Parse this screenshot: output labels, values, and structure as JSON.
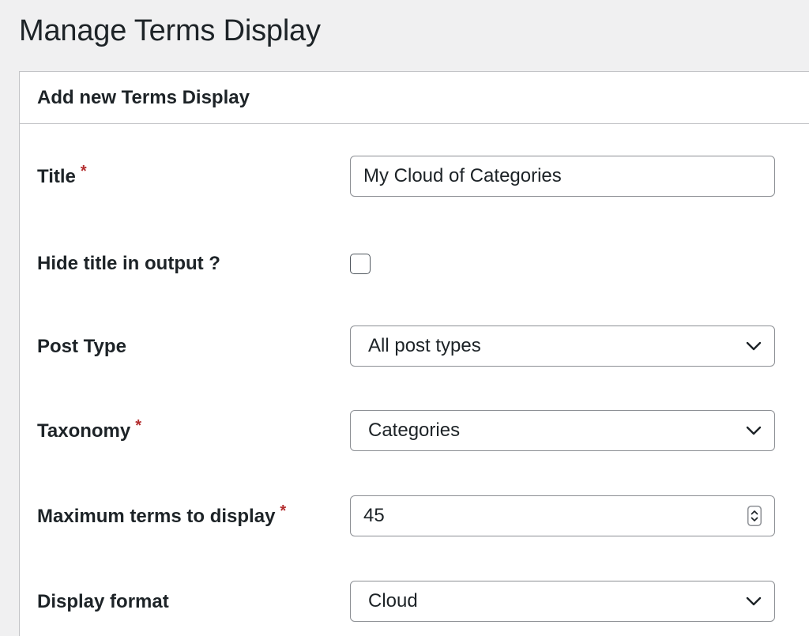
{
  "page": {
    "title": "Manage Terms Display"
  },
  "panel": {
    "heading": "Add new Terms Display"
  },
  "fields": {
    "title": {
      "label": "Title",
      "required_mark": "*",
      "value": "My Cloud of Categories"
    },
    "hide_title": {
      "label": "Hide title in output ?",
      "checked": false
    },
    "post_type": {
      "label": "Post Type",
      "selected": "All post types",
      "icon": "chevron-down-icon"
    },
    "taxonomy": {
      "label": "Taxonomy",
      "required_mark": "*",
      "selected": "Categories",
      "icon": "chevron-down-icon"
    },
    "max_terms": {
      "label": "Maximum terms to display",
      "required_mark": "*",
      "value": "45",
      "icon": "spinner-arrows-icon"
    },
    "display_format": {
      "label": "Display format",
      "selected": "Cloud",
      "icon": "chevron-down-icon"
    }
  },
  "colors": {
    "background": "#f0f0f1",
    "panel": "#ffffff",
    "border": "#c3c4c7",
    "required": "#b32d2e",
    "text": "#1d2327"
  }
}
